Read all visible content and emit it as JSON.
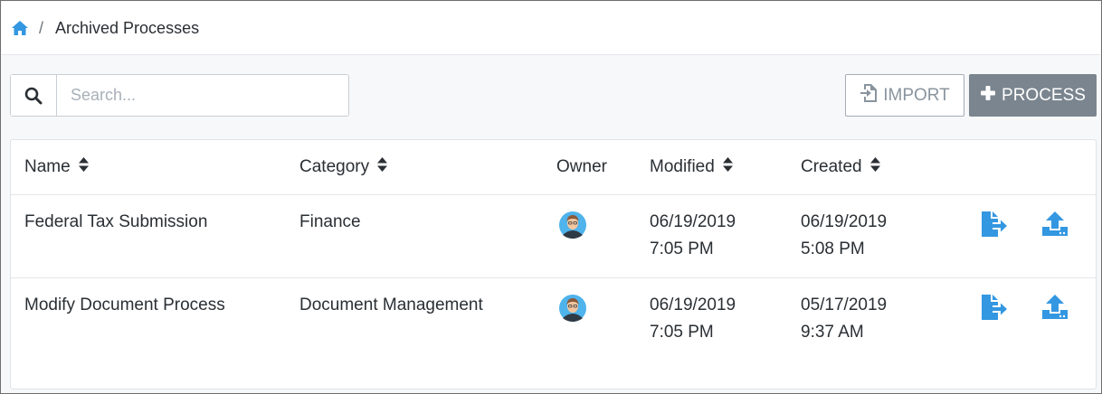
{
  "breadcrumb": {
    "separator": "/",
    "current": "Archived Processes"
  },
  "search": {
    "placeholder": "Search...",
    "value": ""
  },
  "toolbar": {
    "import_label": "IMPORT",
    "process_label": "PROCESS"
  },
  "table": {
    "columns": {
      "name": "Name",
      "category": "Category",
      "owner": "Owner",
      "modified": "Modified",
      "created": "Created"
    },
    "rows": [
      {
        "name": "Federal Tax Submission",
        "category": "Finance",
        "modified_date": "06/19/2019",
        "modified_time": "7:05 PM",
        "created_date": "06/19/2019",
        "created_time": "5:08 PM"
      },
      {
        "name": "Modify Document Process",
        "category": "Document Management",
        "modified_date": "06/19/2019",
        "modified_time": "7:05 PM",
        "created_date": "05/17/2019",
        "created_time": "9:37 AM"
      }
    ]
  },
  "icons": {
    "home": "home-icon",
    "search": "search-icon",
    "import": "file-import-icon",
    "process": "plus-icon",
    "sort": "sort-icon",
    "owner_avatar": "user-avatar",
    "export": "file-export-icon",
    "restore": "upload-icon"
  },
  "colors": {
    "accent": "#3397e1",
    "process_button": "#7a858f",
    "import_border": "#a3acb6"
  }
}
